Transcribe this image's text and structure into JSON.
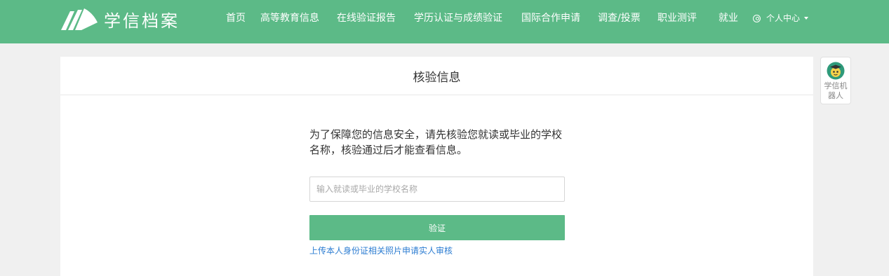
{
  "header": {
    "logo_text": "学信档案",
    "nav": [
      {
        "label": "首页"
      },
      {
        "label": "高等教育信息"
      },
      {
        "label": "在线验证报告"
      },
      {
        "label": "学历认证与成绩验证"
      },
      {
        "label": "国际合作申请"
      },
      {
        "label": "调查/投票"
      },
      {
        "label": "职业测评"
      },
      {
        "label": "就业"
      }
    ],
    "user_center": "个人中心"
  },
  "card": {
    "title": "核验信息",
    "intro": "为了保障您的信息安全，请先核验您就读或毕业的学校名称，核验通过后才能查看信息。",
    "input_placeholder": "输入就读或毕业的学校名称",
    "input_value": "",
    "verify_button": "验证",
    "upload_link": "上传本人身份证相关照片申请实人审核"
  },
  "robot": {
    "label": "学信机器人"
  },
  "colors": {
    "brand_green": "#5cba87",
    "link_blue": "#2d7dd2",
    "page_bg": "#f0f0f0"
  },
  "icons": [
    "logo-icon",
    "user-icon",
    "chevron-down-icon",
    "robot-avatar-icon"
  ]
}
